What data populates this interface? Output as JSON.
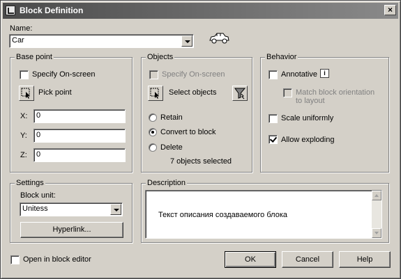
{
  "title": "Block Definition",
  "close_glyph": "×",
  "name": {
    "label": "Name:",
    "value": "Car"
  },
  "base_point": {
    "title": "Base point",
    "specify_onscreen": "Specify On-screen",
    "pick_point": "Pick point",
    "x_label": "X:",
    "x_value": "0",
    "y_label": "Y:",
    "y_value": "0",
    "z_label": "Z:",
    "z_value": "0"
  },
  "objects": {
    "title": "Objects",
    "specify_onscreen": "Specify On-screen",
    "select_objects": "Select objects",
    "retain": "Retain",
    "convert": "Convert to block",
    "delete": "Delete",
    "count_text": "7 objects selected"
  },
  "behavior": {
    "title": "Behavior",
    "annotative": "Annotative",
    "match_orientation": "Match block orientation to layout",
    "scale_uniformly": "Scale uniformly",
    "allow_exploding": "Allow exploding"
  },
  "settings": {
    "title": "Settings",
    "block_unit_label": "Block unit:",
    "block_unit_value": "Unitess",
    "hyperlink": "Hyperlink..."
  },
  "description": {
    "title": "Description",
    "text": "Текст описания создаваемого блока"
  },
  "footer": {
    "open_in_editor": "Open in block editor",
    "ok": "OK",
    "cancel": "Cancel",
    "help": "Help"
  }
}
